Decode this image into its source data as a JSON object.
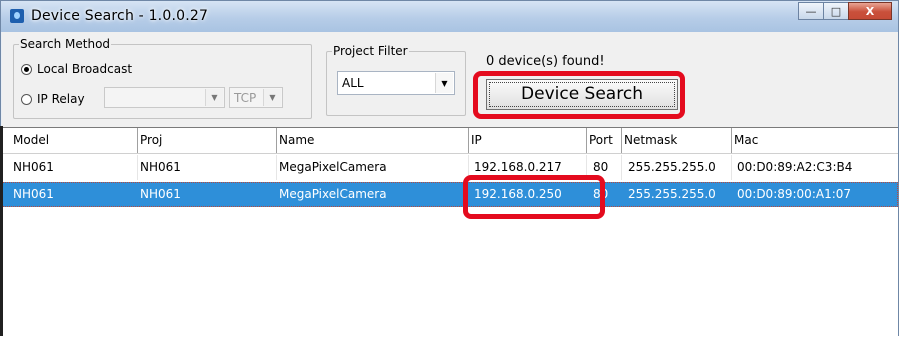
{
  "window": {
    "title": "Device Search - 1.0.0.27",
    "buttons": {
      "minimize": "—",
      "maximize": "□",
      "close": "X"
    }
  },
  "search_method": {
    "legend": "Search Method",
    "options": [
      {
        "label": "Local Broadcast",
        "selected": true
      },
      {
        "label": "IP Relay",
        "selected": false
      }
    ],
    "relay_address": "",
    "relay_protocol": "TCP"
  },
  "project_filter": {
    "legend": "Project Filter",
    "value": "ALL"
  },
  "status": "0 device(s) found!",
  "search_button": "Device Search",
  "table": {
    "columns": [
      "Model",
      "Proj",
      "Name",
      "IP",
      "Port",
      "Netmask",
      "Mac"
    ],
    "rows": [
      {
        "model": "NH061",
        "proj": "NH061",
        "name": "MegaPixelCamera",
        "ip": "192.168.0.217",
        "port": "80",
        "netmask": "255.255.255.0",
        "mac": "00:D0:89:A2:C3:B4",
        "selected": false
      },
      {
        "model": "NH061",
        "proj": "NH061",
        "name": "MegaPixelCamera",
        "ip": "192.168.0.250",
        "port": "80",
        "netmask": "255.255.255.0",
        "mac": "00:D0:89:00:A1:07",
        "selected": true
      }
    ]
  },
  "colors": {
    "highlight": "#e40b1e",
    "selection": "#2e8fd9",
    "title_gradient": "#b7cde8"
  }
}
